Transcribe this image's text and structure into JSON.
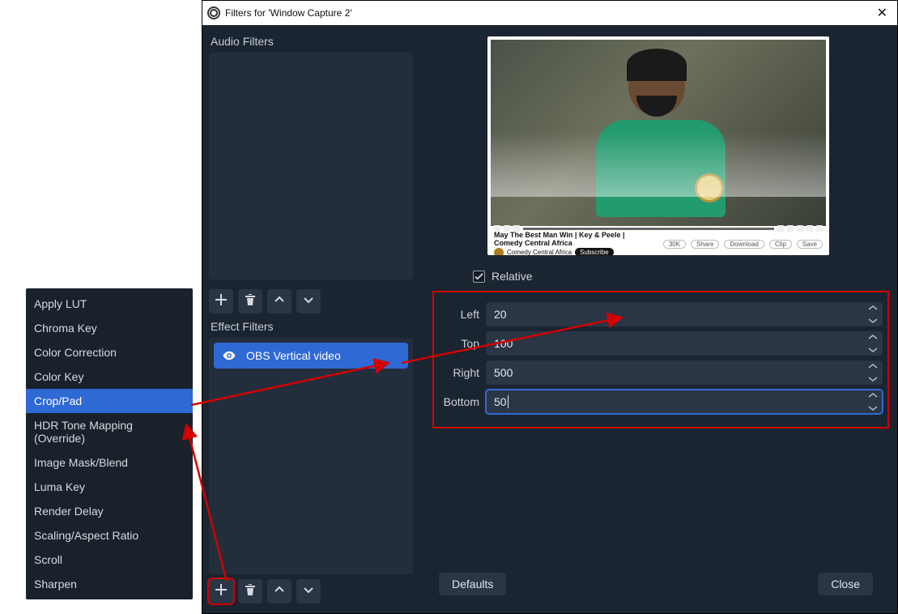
{
  "dialog": {
    "title": "Filters for 'Window Capture 2'",
    "audio_label": "Audio Filters",
    "effect_label": "Effect Filters",
    "effect_item": "OBS Vertical video",
    "defaults_btn": "Defaults",
    "close_btn": "Close"
  },
  "params": {
    "relative_label": "Relative",
    "relative_checked": true,
    "fields": {
      "left": {
        "label": "Left",
        "value": "20"
      },
      "top": {
        "label": "Top",
        "value": "100"
      },
      "right": {
        "label": "Right",
        "value": "500"
      },
      "bottom": {
        "label": "Bottom",
        "value": "50"
      }
    }
  },
  "preview": {
    "video_title": "May The Best Man Win | Key & Peele | Comedy Central Africa",
    "channel": "Comedy Central Africa",
    "subscribe": "Subscribe",
    "chips": [
      "30K",
      "Share",
      "Download",
      "Clip",
      "Save"
    ]
  },
  "ctx_menu": {
    "items": [
      "Apply LUT",
      "Chroma Key",
      "Color Correction",
      "Color Key",
      "Crop/Pad",
      "HDR Tone Mapping (Override)",
      "Image Mask/Blend",
      "Luma Key",
      "Render Delay",
      "Scaling/Aspect Ratio",
      "Scroll",
      "Sharpen"
    ],
    "selected_index": 4
  }
}
